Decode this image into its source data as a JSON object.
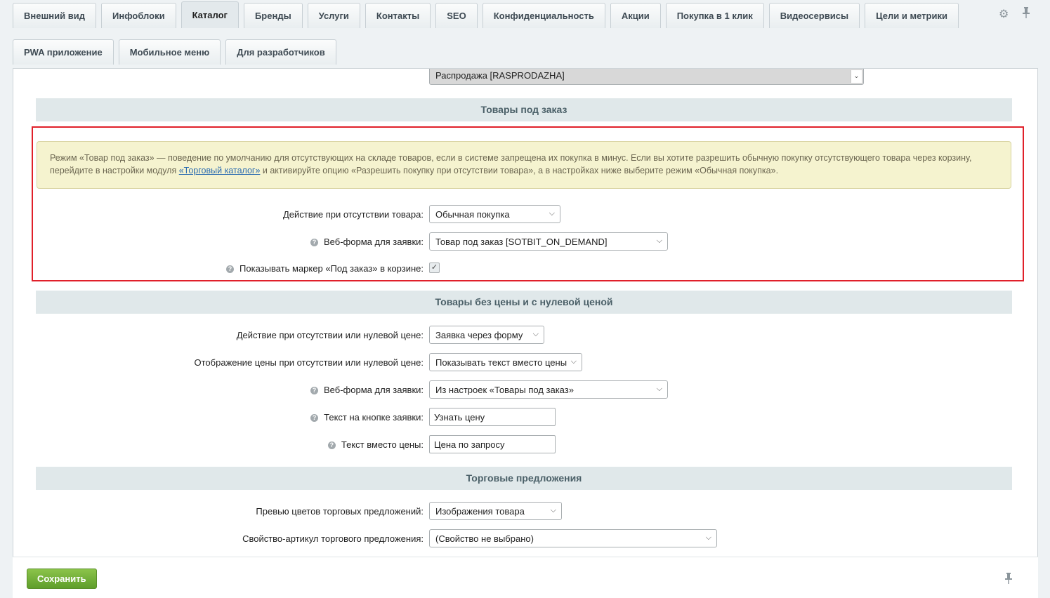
{
  "tabs_row1": [
    "Внешний вид",
    "Инфоблоки",
    "Каталог",
    "Бренды",
    "Услуги",
    "Контакты",
    "SEO",
    "Конфиденциальность",
    "Акции",
    "Покупка в 1 клик",
    "Видеосервисы",
    "Цели и метрики"
  ],
  "tabs_row2": [
    "PWA приложение",
    "Мобильное меню",
    "Для разработчиков"
  ],
  "icons": {
    "settings": "gear-icon",
    "pin": "pin-icon"
  },
  "top_select_value": "Распродажа [RASPRODAZHA]",
  "section_on_demand": {
    "title": "Товары под заказ",
    "notice_before_link": "Режим «Товар под заказ» — поведение по умолчанию для отсутствующих на складе товаров, если в системе запрещена их покупка в минус. Если вы хотите разрешить обычную покупку отсутствующего товара через корзину, перейдите в настройки модуля ",
    "notice_link": "«Торговый каталог»",
    "notice_after_link": " и активируйте опцию «Разрешить покупку при отсутствии товара», а в настройках ниже выберите режим «Обычная покупка».",
    "fields": {
      "action_label": "Действие при отсутствии товара:",
      "action_value": "Обычная покупка",
      "webform_label": "Веб-форма для заявки:",
      "webform_value": "Товар под заказ [SOTBIT_ON_DEMAND]",
      "marker_label": "Показывать маркер «Под заказ» в корзине:",
      "marker_checked": true
    }
  },
  "section_no_price": {
    "title": "Товары без цены и с нулевой ценой",
    "fields": {
      "action_label": "Действие при отсутствии или нулевой цене:",
      "action_value": "Заявка через форму",
      "display_label": "Отображение цены при отсутствии или нулевой цене:",
      "display_value": "Показывать текст вместо цены",
      "webform_label": "Веб-форма для заявки:",
      "webform_value": "Из настроек «Товары под заказ»",
      "button_text_label": "Текст на кнопке заявки:",
      "button_text_value": "Узнать цену",
      "price_text_label": "Текст вместо цены:",
      "price_text_value": "Цена по запросу"
    }
  },
  "section_offers": {
    "title": "Торговые предложения",
    "fields": {
      "preview_label": "Превью цветов торговых предложений:",
      "preview_value": "Изображения товара",
      "article_label": "Свойство-артикул торгового предложения:",
      "article_value": "(Свойство не выбрано)"
    }
  },
  "footer": {
    "save_label": "Сохранить"
  },
  "colors": {
    "save_button": "#6aab34",
    "highlight_border": "#e0202a",
    "notice_bg": "#f5f3cf",
    "section_bg": "#e0e8ea"
  }
}
